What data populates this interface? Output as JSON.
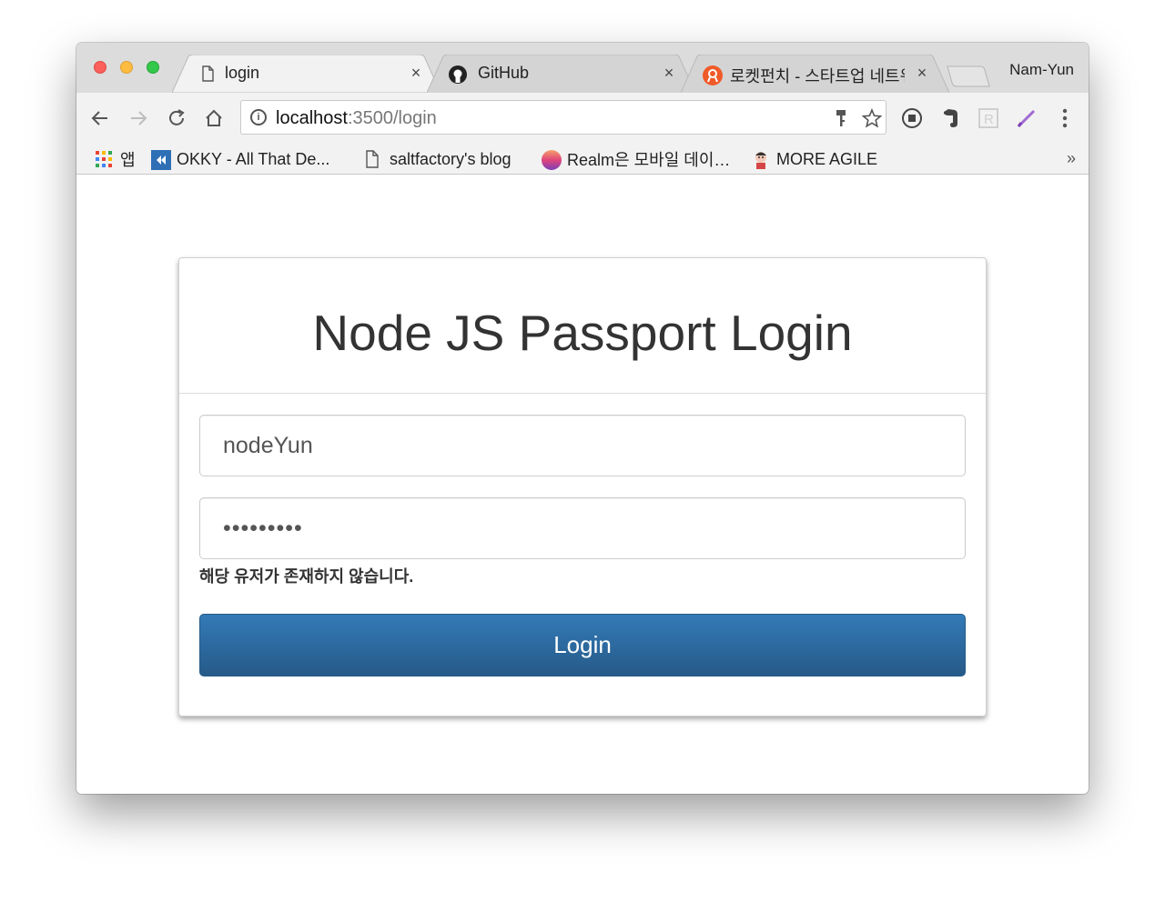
{
  "browser": {
    "profile_name": "Nam-Yun",
    "tabs": [
      {
        "title": "login",
        "icon": "document-icon",
        "active": true
      },
      {
        "title": "GitHub",
        "icon": "github-icon",
        "active": false
      },
      {
        "title": "로켓펀치 - 스타트업 네트워",
        "icon": "rocketpunch-icon",
        "active": false
      }
    ],
    "tab_close_glyph": "×",
    "address": {
      "host": "localhost",
      "rest": ":3500/login"
    },
    "bookmarks": [
      {
        "label": "앱",
        "icon": "apps-grid-icon"
      },
      {
        "label": "OKKY - All That De...",
        "icon": "okky-icon"
      },
      {
        "label": "saltfactory's blog",
        "icon": "document-icon"
      },
      {
        "label": "Realm은 모바일 데이…",
        "icon": "realm-icon"
      },
      {
        "label": "MORE AGILE",
        "icon": "more-agile-icon"
      }
    ],
    "bookmarks_overflow": "»"
  },
  "page": {
    "title": "Node JS Passport Login",
    "username_value": "nodeYun",
    "password_value": "•••••••••",
    "error_message": "해당 유저가 존재하지 않습니다.",
    "login_button": "Login"
  },
  "colors": {
    "button_top": "#337ab7",
    "button_bottom": "#265a88"
  }
}
